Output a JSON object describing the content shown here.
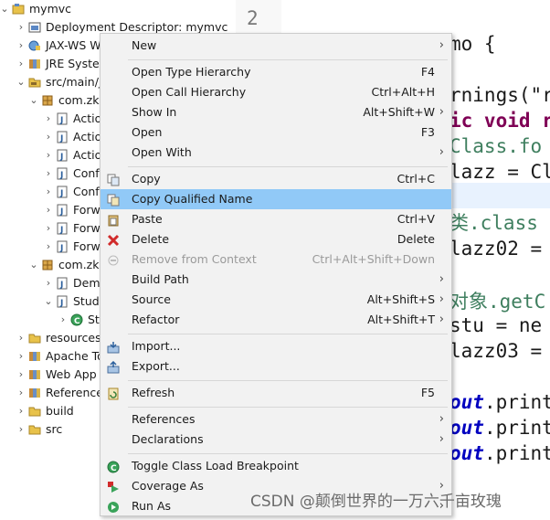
{
  "tree": {
    "items": [
      {
        "label": "mymvc",
        "icon": "project-icon"
      },
      {
        "label": "Deployment Descriptor: mymvc",
        "icon": "deployment-descriptor-icon"
      },
      {
        "label": "JAX-WS W",
        "icon": "jaxws-icon"
      },
      {
        "label": "JRE Syster",
        "icon": "library-icon"
      },
      {
        "label": "src/main/j",
        "icon": "source-folder-icon"
      },
      {
        "label": "com.zki",
        "icon": "package-icon"
      },
      {
        "label": "Actio",
        "icon": "java-file-icon"
      },
      {
        "label": "Actio",
        "icon": "java-file-icon"
      },
      {
        "label": "Actio",
        "icon": "java-file-icon"
      },
      {
        "label": "Conf",
        "icon": "java-file-icon"
      },
      {
        "label": "Conf",
        "icon": "java-file-icon"
      },
      {
        "label": "Forw",
        "icon": "java-file-icon"
      },
      {
        "label": "Forw",
        "icon": "java-file-icon"
      },
      {
        "label": "Forw",
        "icon": "java-file-icon"
      },
      {
        "label": "com.zki",
        "icon": "package-icon"
      },
      {
        "label": "Dem",
        "icon": "java-file-icon"
      },
      {
        "label": "Stud",
        "icon": "java-file-icon"
      },
      {
        "label": "St",
        "icon": "class-icon"
      },
      {
        "label": "resources",
        "icon": "folder-icon"
      },
      {
        "label": "Apache To",
        "icon": "library-icon"
      },
      {
        "label": "Web App",
        "icon": "library-icon"
      },
      {
        "label": "Reference",
        "icon": "library-icon"
      },
      {
        "label": "build",
        "icon": "folder-icon"
      },
      {
        "label": "src",
        "icon": "folder-icon"
      }
    ]
  },
  "editor": {
    "line_number": "2",
    "lines": [
      {
        "parts": [
          {
            "t": "mo {",
            "c": "cls"
          }
        ]
      },
      {
        "parts": [
          {
            "t": "rnings(\"r",
            "c": "cls"
          }
        ]
      },
      {
        "parts": [
          {
            "t": "ic void r",
            "c": "kw"
          }
        ]
      },
      {
        "parts": [
          {
            "t": "Class.fo",
            "c": "cm"
          }
        ]
      },
      {
        "parts": [
          {
            "t": "lazz = Cl",
            "c": "cls"
          }
        ]
      },
      {
        "parts": [
          {
            "t": "类.class",
            "c": "cm"
          }
        ]
      },
      {
        "parts": [
          {
            "t": "lazz02 = ",
            "c": "cls"
          }
        ]
      },
      {
        "parts": [
          {
            "t": "对象.getC",
            "c": "cm"
          }
        ]
      },
      {
        "parts": [
          {
            "t": "stu = ne",
            "c": "cls"
          }
        ]
      },
      {
        "parts": [
          {
            "t": "lazz03 = ",
            "c": "cls"
          }
        ]
      },
      {
        "parts": [
          {
            "t": "out",
            "c": "fld"
          },
          {
            "t": ".print",
            "c": "cls"
          }
        ]
      },
      {
        "parts": [
          {
            "t": "out",
            "c": "fld"
          },
          {
            "t": ".print",
            "c": "cls"
          }
        ]
      },
      {
        "parts": [
          {
            "t": "out",
            "c": "fld"
          },
          {
            "t": ".print",
            "c": "cls"
          }
        ]
      }
    ]
  },
  "menu": {
    "items": [
      {
        "label": "New",
        "shortcut": "",
        "submenu": true,
        "icon": ""
      },
      {
        "label": "Open Type Hierarchy",
        "shortcut": "F4",
        "submenu": false,
        "icon": ""
      },
      {
        "label": "Open Call Hierarchy",
        "shortcut": "Ctrl+Alt+H",
        "submenu": false,
        "icon": ""
      },
      {
        "label": "Show In",
        "shortcut": "Alt+Shift+W",
        "submenu": true,
        "icon": ""
      },
      {
        "label": "Open",
        "shortcut": "F3",
        "submenu": false,
        "icon": ""
      },
      {
        "label": "Open With",
        "shortcut": "",
        "submenu": true,
        "icon": ""
      },
      {
        "label": "Copy",
        "shortcut": "Ctrl+C",
        "submenu": false,
        "icon": "copy-icon"
      },
      {
        "label": "Copy Qualified Name",
        "shortcut": "",
        "submenu": false,
        "icon": "copy-qualified-name-icon",
        "selected": true
      },
      {
        "label": "Paste",
        "shortcut": "Ctrl+V",
        "submenu": false,
        "icon": "paste-icon"
      },
      {
        "label": "Delete",
        "shortcut": "Delete",
        "submenu": false,
        "icon": "delete-icon"
      },
      {
        "label": "Remove from Context",
        "shortcut": "Ctrl+Alt+Shift+Down",
        "submenu": false,
        "icon": "remove-context-icon",
        "disabled": true
      },
      {
        "label": "Build Path",
        "shortcut": "",
        "submenu": true,
        "icon": ""
      },
      {
        "label": "Source",
        "shortcut": "Alt+Shift+S",
        "submenu": true,
        "icon": ""
      },
      {
        "label": "Refactor",
        "shortcut": "Alt+Shift+T",
        "submenu": true,
        "icon": ""
      },
      {
        "label": "Import...",
        "shortcut": "",
        "submenu": false,
        "icon": "import-icon"
      },
      {
        "label": "Export...",
        "shortcut": "",
        "submenu": false,
        "icon": "export-icon"
      },
      {
        "label": "Refresh",
        "shortcut": "F5",
        "submenu": false,
        "icon": "refresh-icon"
      },
      {
        "label": "References",
        "shortcut": "",
        "submenu": true,
        "icon": ""
      },
      {
        "label": "Declarations",
        "shortcut": "",
        "submenu": true,
        "icon": ""
      },
      {
        "label": "Toggle Class Load Breakpoint",
        "shortcut": "",
        "submenu": false,
        "icon": "breakpoint-icon"
      },
      {
        "label": "Coverage As",
        "shortcut": "",
        "submenu": true,
        "icon": "coverage-icon"
      },
      {
        "label": "Run As",
        "shortcut": "",
        "submenu": true,
        "icon": "run-icon"
      }
    ]
  },
  "watermark": "CSDN @颠倒世界的一万六千亩玫瑰",
  "colors": {
    "selection": "#91c9f7",
    "menu_bg": "#f2f2f2",
    "keyword": "#7f0055",
    "comment": "#3f7f5f",
    "field": "#0000c0"
  }
}
